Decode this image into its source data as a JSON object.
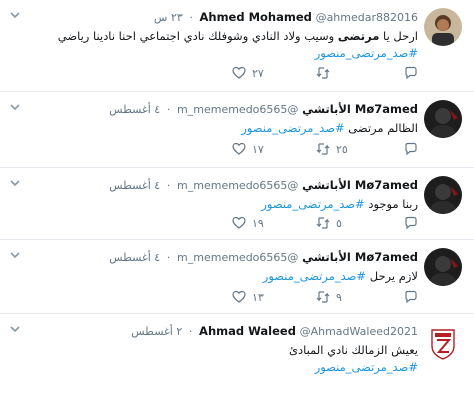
{
  "tweets": [
    {
      "name": "Ahmed Mohamed",
      "handle": "@ahmedar882016",
      "time": "٢٣ س",
      "text_before": "ارحل يا ",
      "text_bold": "مرتضى",
      "text_after": " وسيب ولاد النادي وشوفلك نادي اجتماعي احنا نادينا  رياضي",
      "hashtag": "#صد_مرتضى_منصور",
      "likes": "٢٧",
      "retweets": "",
      "replies": "",
      "avatar": "person-avatar"
    },
    {
      "name": "Mø7amed الأباتشي",
      "handle": "@m_mememedo6565",
      "time": "٤ أغسطس",
      "text_before": "الظالم ",
      "text_bold": "مرتضى",
      "text_after": " ",
      "hashtag": "#صد_مرتضى_منصور",
      "likes": "١٧",
      "retweets": "٢٥",
      "replies": "",
      "avatar": "dark-avatar"
    },
    {
      "name": "Mø7amed الأباتشي",
      "handle": "@m_mememedo6565",
      "time": "٤ أغسطس",
      "text_before": "ربنا موجود ",
      "text_bold": "",
      "text_after": "",
      "hashtag": "#صد_مرتضى_منصور",
      "likes": "١٩",
      "retweets": "٥",
      "replies": "",
      "avatar": "dark-avatar"
    },
    {
      "name": "Mø7amed الأباتشي",
      "handle": "@m_mememedo6565",
      "time": "٤ أغسطس",
      "text_before": "لازم يرحل ",
      "text_bold": "",
      "text_after": "",
      "hashtag": "#صد_مرتضى_منصور",
      "likes": "١٣",
      "retweets": "٩",
      "replies": "",
      "avatar": "dark-avatar"
    },
    {
      "name": "Ahmad Waleed",
      "handle": "@AhmadWaleed2021",
      "time": "٢ أغسطس",
      "text_before": "يعيش الزمالك نادي المبادئ",
      "text_bold": "",
      "text_after": "",
      "hashtag": "#صد_مرتضى_منصور",
      "likes": "",
      "retweets": "",
      "replies": "",
      "avatar": "zamalek-logo"
    }
  ],
  "colors": {
    "hashtag": "#1b95e0",
    "meta": "#657786",
    "border": "#e6ecf0"
  },
  "icons": [
    "chevron-down-icon",
    "reply-icon",
    "retweet-icon",
    "like-icon"
  ]
}
